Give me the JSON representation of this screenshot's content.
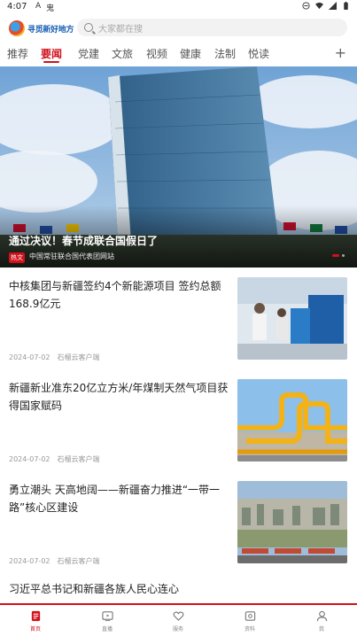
{
  "status_bar": {
    "time": "4:07",
    "left_icons": [
      "A",
      "鬼"
    ]
  },
  "header": {
    "logo_text": "寻觅新好地方",
    "search_placeholder": "大家都在搜"
  },
  "tabs": [
    "推荐",
    "要闻",
    "党建",
    "文旅",
    "视频",
    "健康",
    "法制",
    "悦读"
  ],
  "active_tab": "要闻",
  "hero": {
    "title": "通过决议！春节成联合国假日了",
    "badge": "热文",
    "source": "中国常驻联合国代表团网站"
  },
  "news": [
    {
      "title": "中核集团与新疆签约4个新能源项目 签约总额168.9亿元",
      "date": "2024-07-02",
      "source": "石榴云客户端"
    },
    {
      "title": "新疆新业准东20亿立方米/年煤制天然气项目获得国家赋码",
      "date": "2024-07-02",
      "source": "石榴云客户端"
    },
    {
      "title": "勇立潮头 天高地阔——新疆奋力推进“一带一路”核心区建设",
      "date": "2024-07-02",
      "source": "石榴云客户端"
    }
  ],
  "news_single": {
    "title": "习近平总书记和新疆各族人民心连心"
  },
  "bottom_nav": [
    {
      "label": "首页",
      "icon": "home-doc-icon",
      "active": true
    },
    {
      "label": "直播",
      "icon": "live-tv-icon",
      "active": false
    },
    {
      "label": "服务",
      "icon": "service-heart-icon",
      "active": false
    },
    {
      "label": "资料",
      "icon": "archive-icon",
      "active": false
    },
    {
      "label": "我",
      "icon": "user-icon",
      "active": false
    }
  ],
  "colors": {
    "accent": "#d0111b",
    "brand_blue": "#1a5fb4"
  }
}
